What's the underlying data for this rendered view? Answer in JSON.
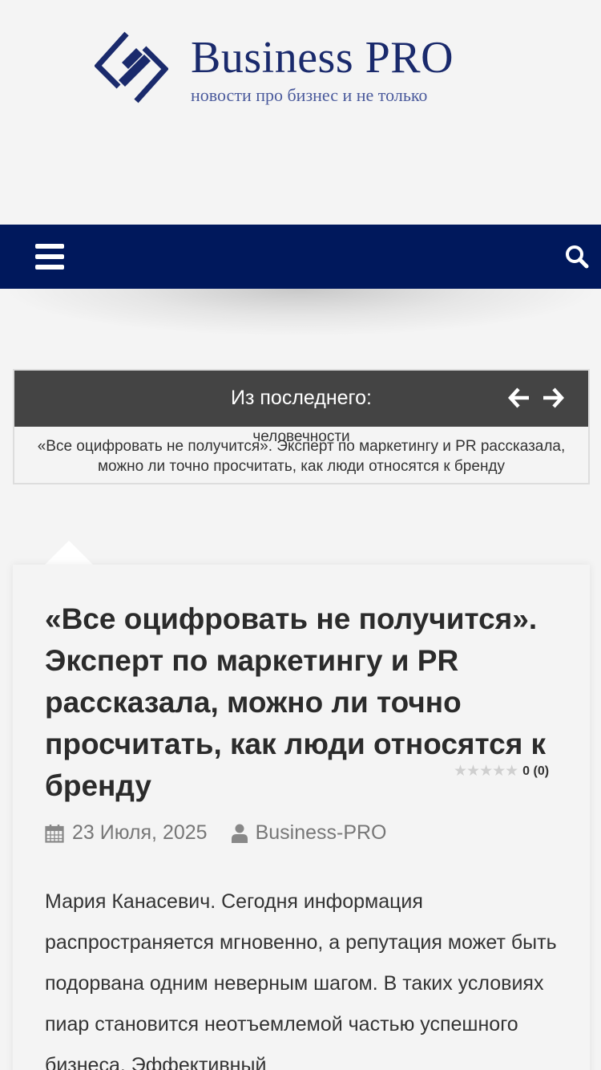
{
  "header": {
    "logo_title": "Business PRO",
    "logo_tagline": "новости про бизнес и не только",
    "brand_color": "#1a2a6c"
  },
  "navbar": {
    "background": "#00185c",
    "menu_icon": "hamburger-menu-icon",
    "search_icon": "search-icon"
  },
  "ticker": {
    "title": "Из последнего:",
    "prev_icon": "arrow-left-icon",
    "next_icon": "arrow-right-icon",
    "previous_item": "человечности",
    "current_item": "«Все оцифровать не получится». Эксперт по маркетингу и PR рассказала, можно ли точно просчитать, как люди относятся к бренду"
  },
  "article": {
    "title": "«Все оцифровать не получится». Эксперт по маркетингу и PR рассказала, можно ли точно просчитать, как люди относятся к бренду",
    "rating_stars": 0,
    "rating_text": "0 (0)",
    "date": "23 Июля, 2025",
    "author": "Business-PRO",
    "body": "Мария Канасевич. Сегодня информация распространяется мгновенно, а репутация может быть подорвана одним неверным шагом. В таких условиях пиар становится неотъемлемой частью успешного бизнеса. Эффективный"
  }
}
